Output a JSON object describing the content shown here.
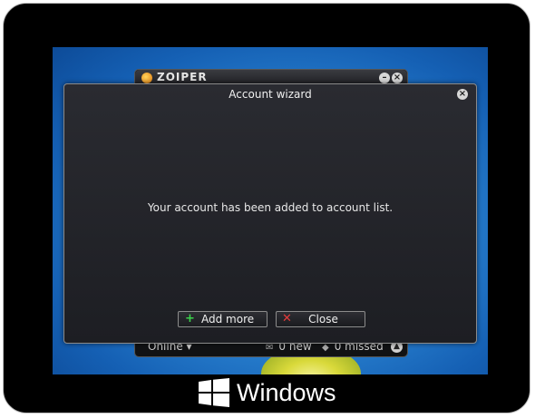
{
  "device": {
    "brand_text": "Windows"
  },
  "zoiper": {
    "logo_text": "ZOIPER",
    "minimize_glyph": "–",
    "close_glyph": "×",
    "status": {
      "online_label": "Online ▾",
      "new_label": "0 new",
      "missed_label": "0 missed",
      "expand_glyph": "▲"
    }
  },
  "wizard": {
    "title": "Account wizard",
    "close_glyph": "×",
    "message": "Your account has been added to account list.",
    "add_more_label": "Add more",
    "add_more_glyph": "+",
    "close_label": "Close",
    "close_button_glyph": "✕"
  },
  "colors": {
    "accent_add": "#3bd34b",
    "accent_close": "#e53b3b",
    "desktop_blue": "#2c86d4"
  }
}
